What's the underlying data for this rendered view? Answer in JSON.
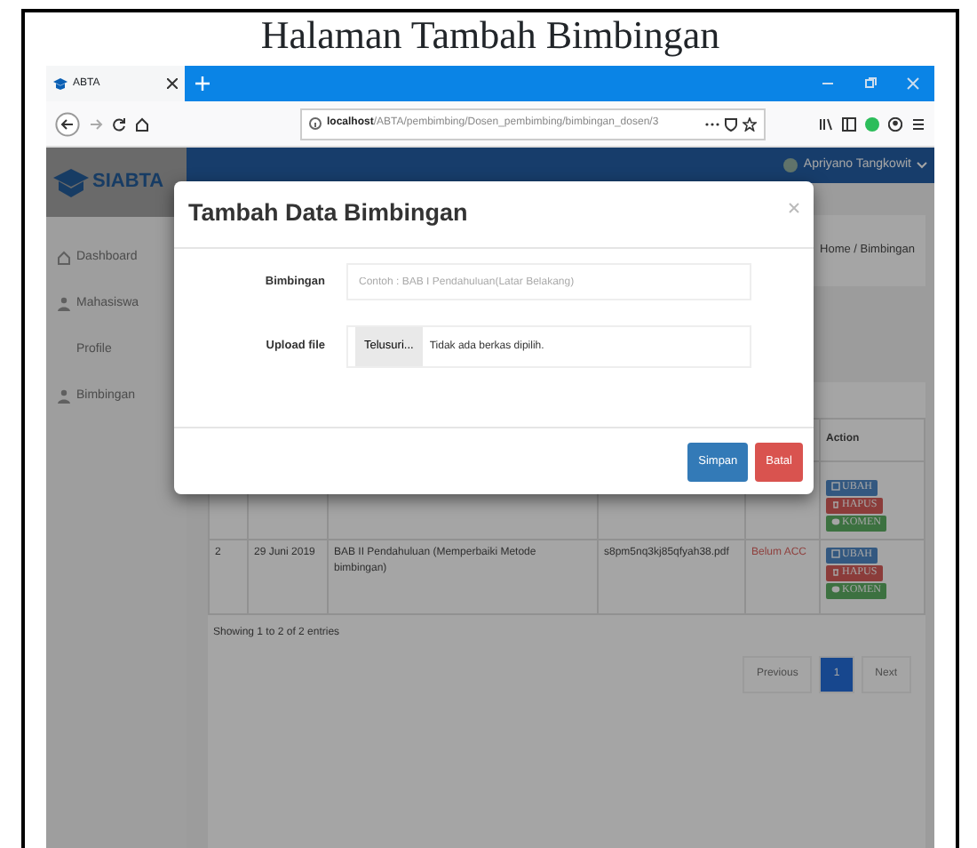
{
  "caption": "Halaman Tambah Bimbingan",
  "browser": {
    "tab_title": "ABTA",
    "url": "**localhost**/ABTA/pembimbing/Dosen_pembimbing/bimbingan_dosen/3"
  },
  "app": {
    "brand": "SIABTA",
    "user_name": "Apriyano Tangkowit",
    "sidebar": [
      {
        "label": "Dashboard",
        "kind": "home"
      },
      {
        "label": "Mahasiswa",
        "kind": "user"
      },
      {
        "label": "Profile",
        "kind": "plain"
      },
      {
        "label": "Bimbingan",
        "kind": "user"
      }
    ],
    "breadcrumb": "Home / Bimbingan",
    "table": {
      "columns": [
        "Action"
      ],
      "rows": [
        {
          "cells": [],
          "actions": [
            {
              "label": "UBAH",
              "kind": "edit"
            },
            {
              "label": "HAPUS",
              "kind": "delete"
            },
            {
              "label": "KOMEN",
              "kind": "comment"
            }
          ]
        },
        {
          "cells": [
            "2",
            "29 Juni 2019",
            "BAB II Pendahuluan (Memperbaiki Metode bimbingan)",
            "s8pm5nq3kj85qfyah38.pdf",
            "Belum ACC"
          ],
          "actions": [
            {
              "label": "UBAH",
              "kind": "edit"
            },
            {
              "label": "HAPUS",
              "kind": "delete"
            },
            {
              "label": "KOMEN",
              "kind": "comment"
            }
          ]
        }
      ]
    },
    "info": "Showing 1 to 2 of 2 entries",
    "pagination": [
      {
        "label": "Previous",
        "selected": false
      },
      {
        "label": "1",
        "selected": true
      },
      {
        "label": "Next",
        "selected": false
      }
    ]
  },
  "modal": {
    "title": "Tambah Data Bimbingan",
    "fields": [
      {
        "label": "Bimbingan",
        "kind": "text",
        "placeholder": "Contoh : BAB I Pendahuluan(Latar Belakang)"
      },
      {
        "label": "Upload file",
        "kind": "file",
        "button": "Telusuri...",
        "status": "Tidak ada berkas dipilih."
      }
    ],
    "buttons": [
      {
        "label": "Simpan",
        "kind": "primary"
      },
      {
        "label": "Batal",
        "kind": "danger"
      }
    ]
  }
}
